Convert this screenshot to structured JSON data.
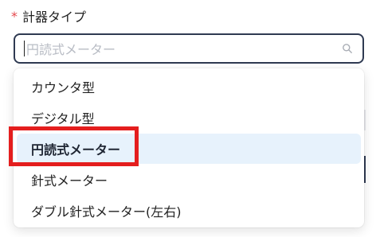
{
  "field": {
    "required_mark": "*",
    "label": "計器タイプ"
  },
  "search": {
    "placeholder": "円読式メーター",
    "icon": "search-icon"
  },
  "dropdown": {
    "options": [
      {
        "label": "カウンタ型",
        "selected": false
      },
      {
        "label": "デジタル型",
        "selected": false
      },
      {
        "label": "円読式メーター",
        "selected": true
      },
      {
        "label": "針式メーター",
        "selected": false
      },
      {
        "label": "ダブル針式メーター(左右)",
        "selected": false
      }
    ]
  },
  "colors": {
    "required": "#e5484d",
    "active_option_bg": "#e7f2fc",
    "highlight_border": "#e41e1e",
    "input_border": "#2f3a52"
  }
}
